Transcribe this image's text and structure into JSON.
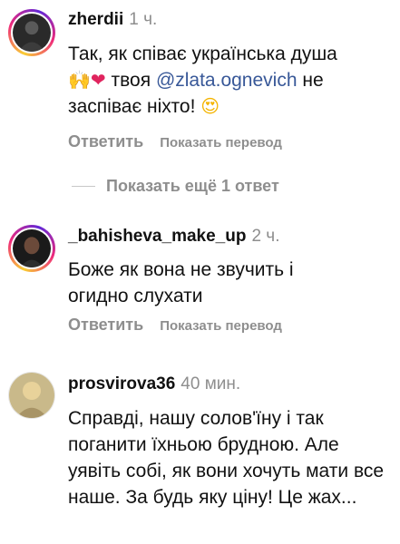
{
  "comments": [
    {
      "username": "zherdii",
      "time": "1 ч.",
      "text_line1": "Так, як співає українська душа",
      "emoji_hands": "🙌",
      "emoji_heart": "❤",
      "text_mid": " твоя ",
      "mention": "@zlata.ognevich",
      "text_after_mention": " не заспіває ніхто! ",
      "emoji_face": "😍",
      "reply_label": "Ответить",
      "translate_label": "Показать перевод"
    },
    {
      "username": "_bahisheva_make_up",
      "time": "2 ч.",
      "text": "Боже як вона не звучить і огидно слухати",
      "reply_label": "Ответить",
      "translate_label": "Показать перевод"
    },
    {
      "username": "prosvirova36",
      "time": "40 мин.",
      "text": "Справді, нашу солов'їну і так поганити їхньою брудною. Але уявіть собі, як вони хочуть мати все наше. За будь яку ціну! Це жах..."
    }
  ],
  "show_more_replies": "Показать ещё 1 ответ",
  "colors": {
    "mention": "#385898",
    "muted": "#8e8e8e",
    "text": "#111111"
  }
}
